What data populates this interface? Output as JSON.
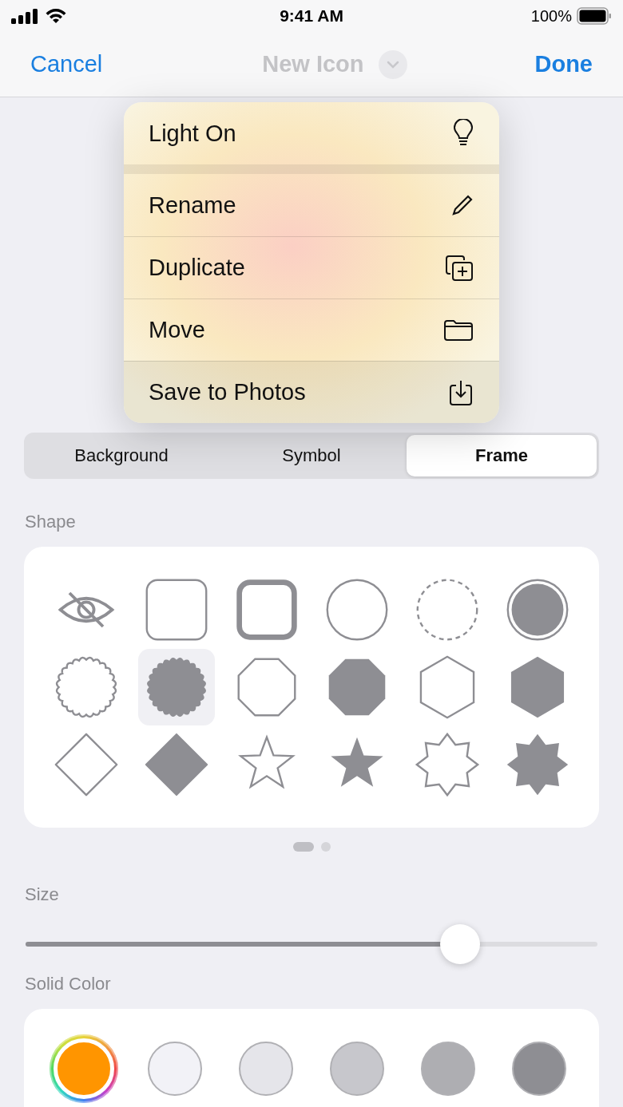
{
  "status_bar": {
    "time": "9:41 AM",
    "battery": "100%"
  },
  "nav": {
    "cancel": "Cancel",
    "title": "New Icon",
    "done": "Done"
  },
  "segments": [
    {
      "label": "Background",
      "selected": false
    },
    {
      "label": "Symbol",
      "selected": false
    },
    {
      "label": "Frame",
      "selected": true
    }
  ],
  "shape_section": {
    "title": "Shape",
    "shapes": [
      {
        "kind": "none",
        "selected": false
      },
      {
        "kind": "rounded-square",
        "selected": false
      },
      {
        "kind": "rounded-square-thick",
        "selected": false
      },
      {
        "kind": "circle",
        "selected": false
      },
      {
        "kind": "circle-dashed",
        "selected": false
      },
      {
        "kind": "circle-ring",
        "selected": false
      },
      {
        "kind": "scallop",
        "selected": false
      },
      {
        "kind": "scallop-filled",
        "selected": true
      },
      {
        "kind": "octagon",
        "selected": false
      },
      {
        "kind": "octagon-filled",
        "selected": false
      },
      {
        "kind": "hexagon",
        "selected": false
      },
      {
        "kind": "hexagon-filled",
        "selected": false
      },
      {
        "kind": "diamond",
        "selected": false
      },
      {
        "kind": "diamond-filled",
        "selected": false
      },
      {
        "kind": "star",
        "selected": false
      },
      {
        "kind": "star-filled",
        "selected": false
      },
      {
        "kind": "burst",
        "selected": false
      },
      {
        "kind": "burst-filled",
        "selected": false
      }
    ],
    "pages": [
      {
        "selected": true
      },
      {
        "selected": false
      }
    ]
  },
  "size": {
    "title": "Size",
    "level": 0.76
  },
  "color_section": {
    "title": "Solid Color",
    "colors": [
      {
        "kind": "picker",
        "color": "#ff9500",
        "selected": true
      },
      {
        "kind": "swatch",
        "color": "#f2f2f7",
        "selected": false
      },
      {
        "kind": "swatch",
        "color": "#e5e5ea",
        "selected": false
      },
      {
        "kind": "swatch",
        "color": "#c7c7cc",
        "selected": false
      },
      {
        "kind": "swatch",
        "color": "#aeaeb2",
        "selected": false
      },
      {
        "kind": "swatch",
        "color": "#8e8e93",
        "selected": false
      }
    ]
  },
  "menu": {
    "sections": [
      {
        "items": [
          {
            "label": "Light On",
            "kind": "bulb",
            "highlighted": false
          }
        ]
      },
      {
        "items": [
          {
            "label": "Rename",
            "kind": "pencil",
            "highlighted": false
          },
          {
            "label": "Duplicate",
            "kind": "duplicate",
            "highlighted": false
          },
          {
            "label": "Move",
            "kind": "folder",
            "highlighted": false
          },
          {
            "label": "Save to Photos",
            "kind": "download",
            "highlighted": true
          }
        ]
      }
    ]
  }
}
